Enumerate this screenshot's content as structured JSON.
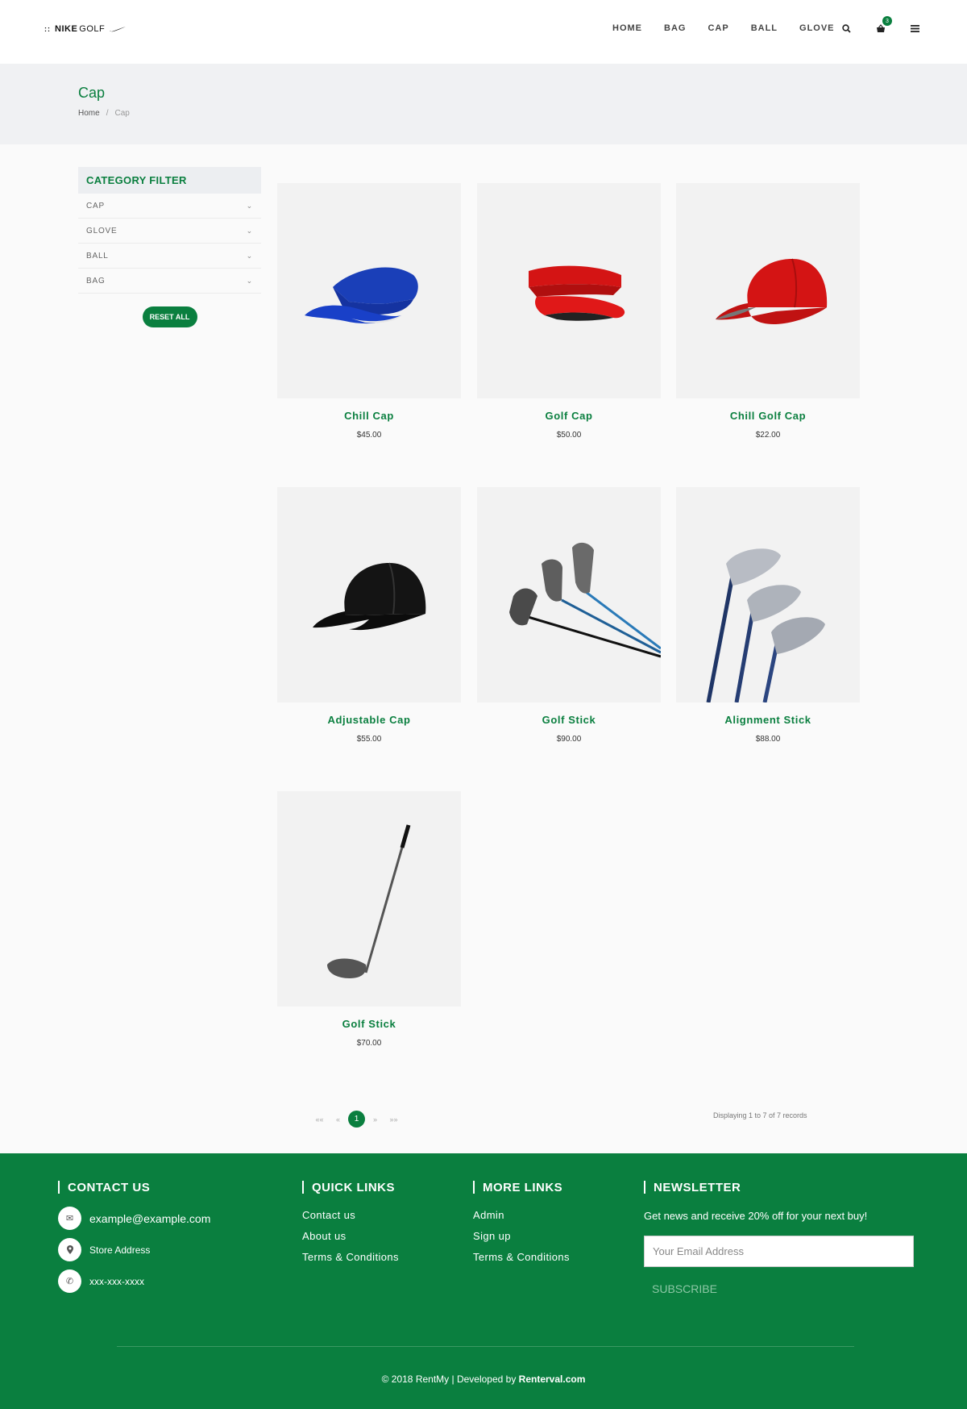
{
  "header": {
    "logo": {
      "dots": "::",
      "nike": "NIKE",
      "golf": "GOLF"
    },
    "nav": [
      "HOME",
      "BAG",
      "CAP",
      "BALL",
      "GLOVE"
    ],
    "cart_count": "3"
  },
  "banner": {
    "title": "Cap",
    "breadcrumb": {
      "home": "Home",
      "separator": "/",
      "current": "Cap"
    }
  },
  "sidebar": {
    "filter_title": "CATEGORY FILTER",
    "categories": [
      "CAP",
      "GLOVE",
      "BALL",
      "BAG"
    ],
    "reset_label": "RESET ALL"
  },
  "products": [
    {
      "name": "Chill Cap",
      "price": "$45.00",
      "icon": "blue-visor-image"
    },
    {
      "name": "Golf Cap",
      "price": "$50.00",
      "icon": "red-visor-image"
    },
    {
      "name": "Chill Golf Cap",
      "price": "$22.00",
      "icon": "red-cap-image"
    },
    {
      "name": "Adjustable Cap",
      "price": "$55.00",
      "icon": "black-cap-image"
    },
    {
      "name": "Golf Stick",
      "price": "$90.00",
      "icon": "golf-clubs-image"
    },
    {
      "name": "Alignment Stick",
      "price": "$88.00",
      "icon": "iron-clubs-image"
    },
    {
      "name": "Golf Stick",
      "price": "$70.00",
      "icon": "driver-club-image"
    }
  ],
  "pagination": {
    "first": "««",
    "prev": "«",
    "current": "1",
    "next": "»",
    "last": "»»",
    "records": "Displaying 1 to 7 of 7 records"
  },
  "footer": {
    "contact": {
      "title": "CONTACT US",
      "email": "example@example.com",
      "address": "Store Address",
      "phone": "xxx-xxx-xxxx"
    },
    "quick_links": {
      "title": "QUICK LINKS",
      "items": [
        "Contact us",
        "About us",
        "Terms & Conditions"
      ]
    },
    "more_links": {
      "title": "MORE LINKS",
      "items": [
        "Admin",
        "Sign up",
        "Terms & Conditions"
      ]
    },
    "newsletter": {
      "title": "NEWSLETTER",
      "text": "Get news and receive 20% off for your next buy!",
      "placeholder": "Your Email Address",
      "button": "SUBSCRIBE"
    },
    "copyright": "© 2018 RentMy | Developed by",
    "developer": "Renterval.com"
  },
  "colors": {
    "brand": "#0a7f3f",
    "banner_bg": "#f0f1f3",
    "page_bg": "#fafafa"
  }
}
